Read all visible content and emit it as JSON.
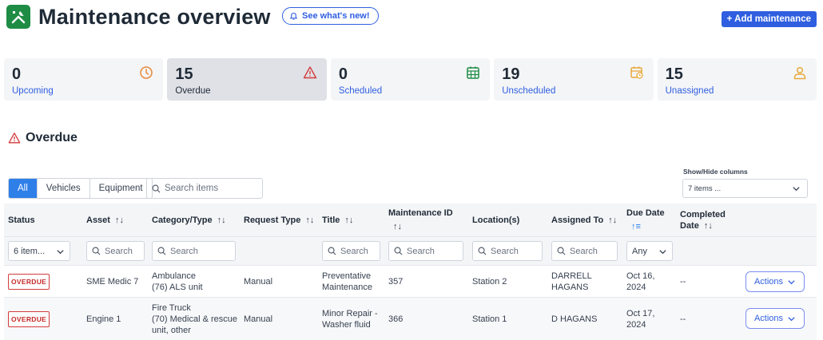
{
  "header": {
    "title": "Maintenance overview",
    "whats_new": "See what's new!",
    "add_button": "+ Add maintenance"
  },
  "cards": [
    {
      "count": "0",
      "label": "Upcoming",
      "icon": "clock-icon",
      "color": "#e8893a"
    },
    {
      "count": "15",
      "label": "Overdue",
      "icon": "warning-triangle-icon",
      "color": "#d33b3b"
    },
    {
      "count": "0",
      "label": "Scheduled",
      "icon": "calendar-grid-icon",
      "color": "#1e8c45"
    },
    {
      "count": "19",
      "label": "Unscheduled",
      "icon": "calendar-clock-icon",
      "color": "#e8a93a"
    },
    {
      "count": "15",
      "label": "Unassigned",
      "icon": "user-icon",
      "color": "#e8a93a"
    }
  ],
  "section": {
    "title": "Overdue"
  },
  "filters": {
    "tabs": [
      "All",
      "Vehicles",
      "Equipment"
    ],
    "active_tab": "All",
    "search_placeholder": "Search items",
    "show_hide_label": "Show/Hide columns",
    "show_hide_value": "7 items ..."
  },
  "table": {
    "columns": {
      "status": "Status",
      "asset": "Asset",
      "category": "Category/Type",
      "request": "Request Type",
      "title": "Title",
      "maint_id": "Maintenance ID",
      "location": "Location(s)",
      "assigned": "Assigned To",
      "due": "Due Date",
      "completed_1": "Completed",
      "completed_2": "Date"
    },
    "filters": {
      "status": "6 item...",
      "search": "Search",
      "due": "Any"
    },
    "rows": [
      {
        "status": "OVERDUE",
        "asset": "SME Medic 7",
        "category_1": "Ambulance",
        "category_2": "(76) ALS unit",
        "category_3": "",
        "request": "Manual",
        "title_1": "Preventative",
        "title_2": "Maintenance",
        "maint_id": "357",
        "location": "Station 2",
        "assigned_1": "DARRELL",
        "assigned_2": "HAGANS",
        "due_1": "Oct 16,",
        "due_2": "2024",
        "completed": "--",
        "action": "Actions"
      },
      {
        "status": "OVERDUE",
        "asset": "Engine 1",
        "category_1": "Fire Truck",
        "category_2": "(70) Medical & rescue",
        "category_3": "unit, other",
        "request": "Manual",
        "title_1": "Minor Repair -",
        "title_2": "Washer fluid",
        "maint_id": "366",
        "location": "Station 1",
        "assigned_1": "D HAGANS",
        "assigned_2": "",
        "due_1": "Oct 17,",
        "due_2": "2024",
        "completed": "--",
        "action": "Actions"
      }
    ]
  }
}
